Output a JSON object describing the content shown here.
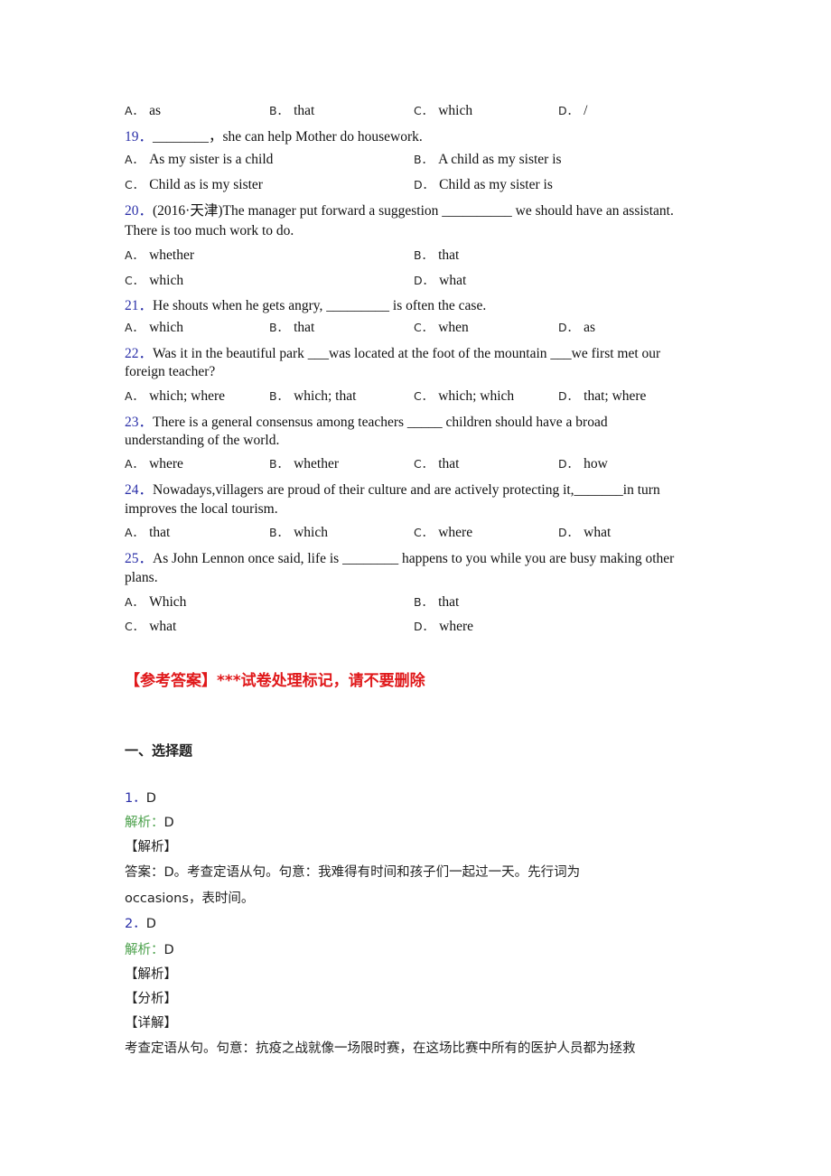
{
  "q18_options": [
    "as",
    "that",
    "which",
    "/"
  ],
  "option_letters": [
    "A．",
    "B．",
    "C．",
    "D．"
  ],
  "questions": [
    {
      "num": "19．",
      "lines": [
        "________，she can help Mother do housework."
      ],
      "options": [
        "As my sister is a child",
        "A child as my sister is",
        "Child as is my sister",
        "Child as my sister is"
      ]
    },
    {
      "num": "20．",
      "lines": [
        "(2016·天津)The manager put forward a suggestion __________ we should have an assistant.",
        "There is too much work to do."
      ],
      "options": [
        "whether",
        "that",
        "which",
        "what"
      ]
    },
    {
      "num": "21．",
      "lines": [
        "He shouts when he gets angry, _________ is often the case."
      ],
      "options": [
        "which",
        "that",
        "when",
        "as"
      ]
    },
    {
      "num": "22．",
      "lines": [
        "Was it in the beautiful park ___was located at the foot of the mountain ___we first met our",
        "foreign teacher?"
      ],
      "options": [
        "which; where",
        "which; that",
        "which; which",
        "that; where"
      ]
    },
    {
      "num": "23．",
      "lines": [
        "There is a general consensus among teachers _____ children should have a broad",
        "understanding of the world."
      ],
      "options": [
        "where",
        "whether",
        "that",
        "how"
      ]
    },
    {
      "num": "24．",
      "lines": [
        "Nowadays,villagers are proud of their culture and are actively protecting it,_______in turn",
        "improves the local tourism."
      ],
      "options": [
        "that",
        "which",
        "where",
        "what"
      ]
    },
    {
      "num": "25．",
      "lines": [
        "As John Lennon once said, life is ________ happens to you while you are busy making other",
        "plans."
      ],
      "options": [
        "Which",
        "that",
        "what",
        "where"
      ]
    }
  ],
  "answer_header": "【参考答案】***试卷处理标记，请不要删除",
  "section_title": "一、选择题",
  "answers": [
    {
      "num": "1．",
      "answer": "D",
      "analysis_label": "解析：",
      "analysis_value": "D",
      "tags": [
        "【解析】"
      ],
      "text_lines": [
        "答案：D。考查定语从句。句意：我难得有时间和孩子们一起过一天。先行词为",
        "occasions，表时间。"
      ]
    },
    {
      "num": "2．",
      "answer": "D",
      "analysis_label": "解析：",
      "analysis_value": "D",
      "tags": [
        "【解析】",
        "【分析】",
        "【详解】"
      ],
      "text_lines": [
        "考查定语从句。句意：抗疫之战就像一场限时赛，在这场比赛中所有的医护人员都为拯救"
      ]
    }
  ]
}
